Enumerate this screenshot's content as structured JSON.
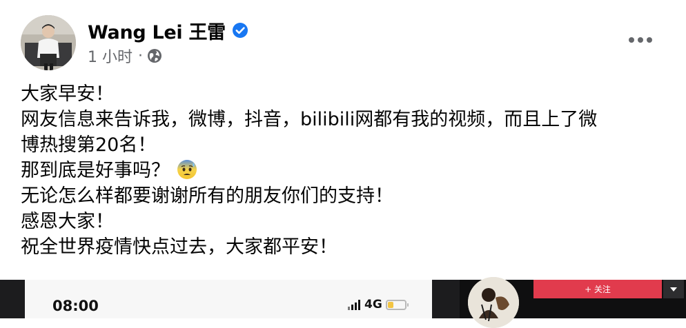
{
  "post": {
    "author_name": "Wang Lei 王雷",
    "timestamp": "1 小时",
    "separator": "·",
    "audience_icon": "globe-icon",
    "verified_icon": "verified-badge-icon",
    "more_icon": "more-options-icon",
    "body_lines": [
      "大家早安！",
      "网友信息来告诉我，微博，抖音，bilibili网都有我的视频，而且上了微",
      "博热搜第20名！",
      "那到底是好事吗？",
      "无论怎么样都要谢谢所有的朋友你们的支持！",
      "感恩大家！",
      "祝全世界疫情快点过去，大家都平安！"
    ],
    "emoji": "anxious-face-with-sweat-icon"
  },
  "media": {
    "left": {
      "phone_time": "08:00",
      "network": "4G",
      "signal_icon": "signal-bars-icon",
      "battery_icon": "battery-icon",
      "battery_level": 0.35
    },
    "right": {
      "follow_label": "+ 关注",
      "dropdown_icon": "caret-down-icon"
    }
  },
  "colors": {
    "text_primary": "#050505",
    "text_secondary": "#65676b",
    "verified_blue": "#1877f2",
    "follow_red": "#e13b4d"
  }
}
